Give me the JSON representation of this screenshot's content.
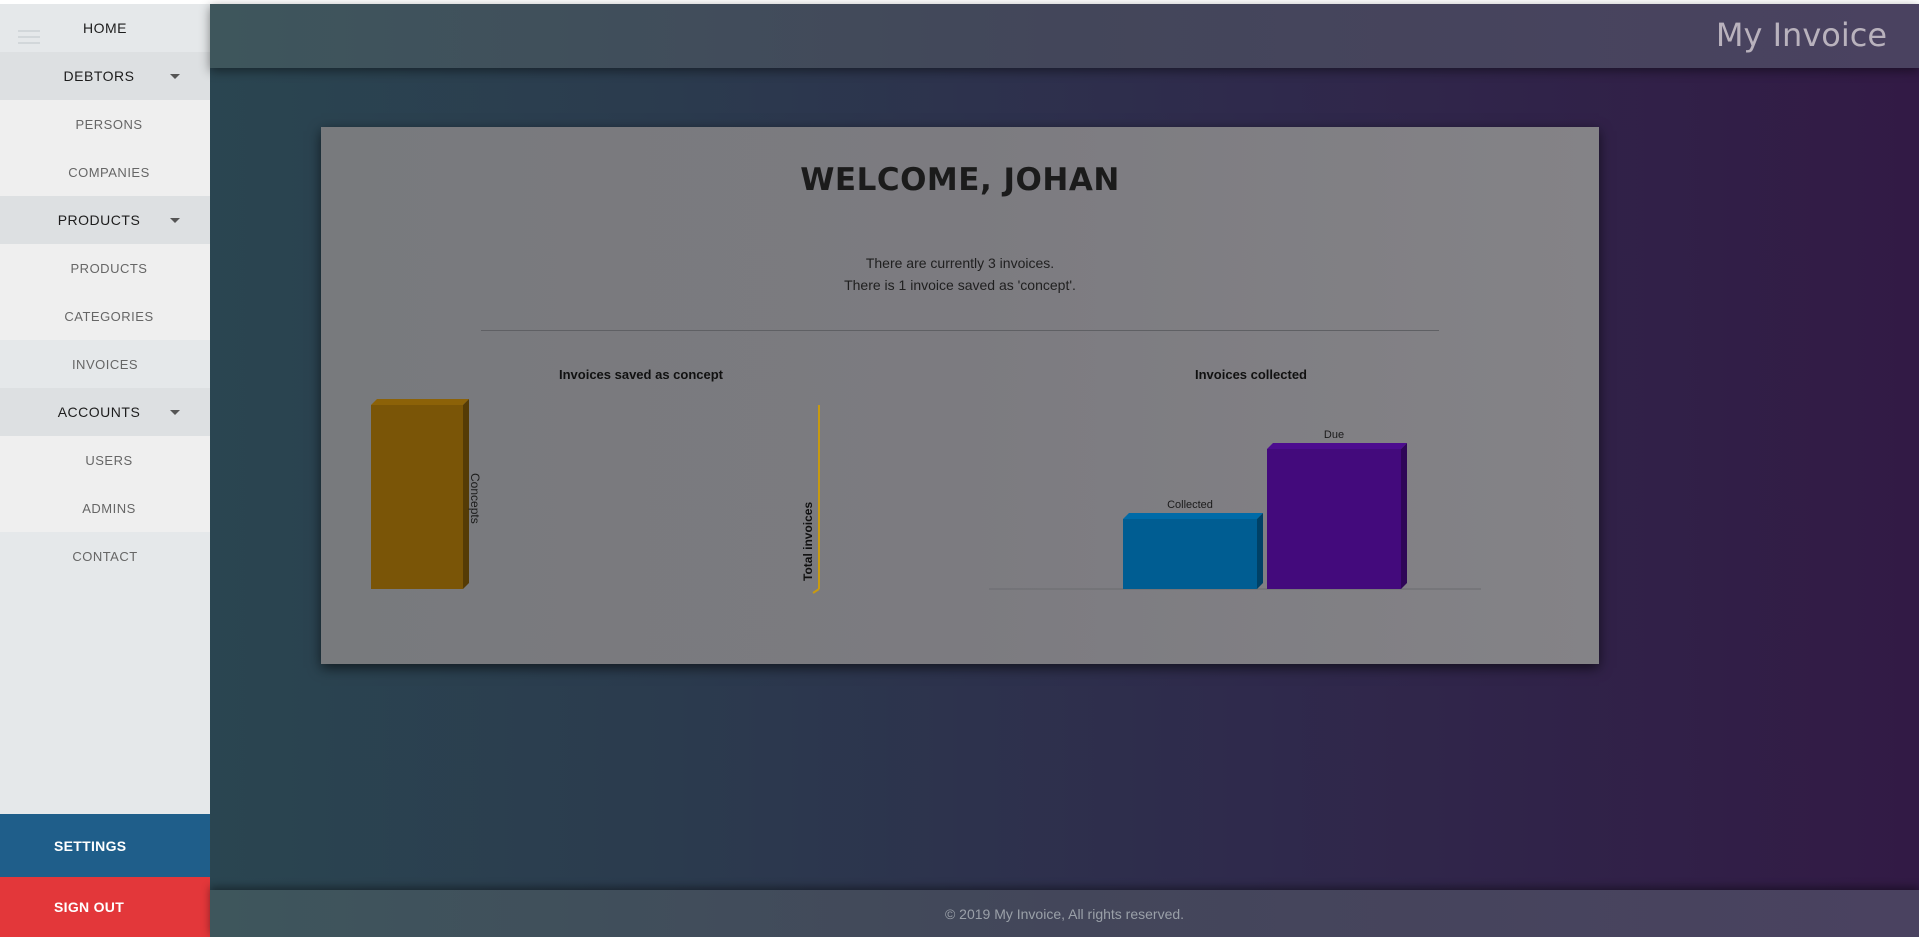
{
  "app": {
    "title": "My Invoice"
  },
  "sidebar": {
    "items": [
      {
        "label": "HOME"
      },
      {
        "label": "DEBTORS"
      },
      {
        "label": "PERSONS"
      },
      {
        "label": "COMPANIES"
      },
      {
        "label": "PRODUCTS"
      },
      {
        "label": "PRODUCTS"
      },
      {
        "label": "CATEGORIES"
      },
      {
        "label": "INVOICES"
      },
      {
        "label": "ACCOUNTS"
      },
      {
        "label": "USERS"
      },
      {
        "label": "ADMINS"
      },
      {
        "label": "CONTACT"
      }
    ],
    "settings_label": "SETTINGS",
    "signout_label": "SIGN OUT"
  },
  "main": {
    "welcome": "WELCOME, JOHAN",
    "info_line1": "There are currently 3 invoices.",
    "info_line2": "There is 1 invoice saved as 'concept'."
  },
  "chart_data": [
    {
      "type": "bar",
      "title": "Invoices saved as concept",
      "categories": [
        "Concepts"
      ],
      "values": [
        1
      ],
      "ylabel": "Total invoices",
      "colors": [
        "#7a5507"
      ],
      "axis_color": "#c89a10"
    },
    {
      "type": "bar",
      "title": "Invoices collected",
      "categories": [
        "Collected",
        "Due"
      ],
      "values": [
        1,
        2
      ],
      "colors": [
        "#005d92",
        "#430a7c"
      ]
    }
  ],
  "footer": {
    "text": "© 2019 My Invoice, All rights reserved."
  },
  "colors": {
    "settings": "#1f5e8a",
    "signout": "#e3373a",
    "sidebar_bg": "#e5e8ea"
  }
}
